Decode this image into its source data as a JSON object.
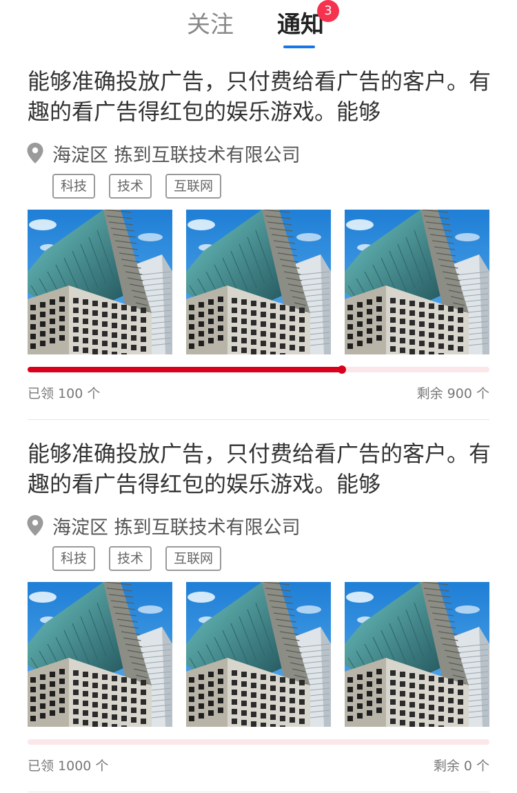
{
  "tabs": {
    "follow": "关注",
    "notice": "通知",
    "notice_badge": "3"
  },
  "colors": {
    "accent_blue": "#1677e8",
    "badge_red": "#f5334f",
    "progress_red": "#d9001b",
    "progress_track": "#fbe7e9"
  },
  "cards": [
    {
      "title": "能够准确投放广告，只付费给看广告的客户。有趣的看广告得红包的娱乐游戏。能够",
      "location": "海淀区 拣到互联技术有限公司",
      "tags": [
        "科技",
        "技术",
        "互联网"
      ],
      "images": [
        "building-photo",
        "building-photo",
        "building-photo"
      ],
      "progress_fraction": 0.68,
      "claimed": "已领 100 个",
      "remaining": "剩余 900 个"
    },
    {
      "title": "能够准确投放广告，只付费给看广告的客户。有趣的看广告得红包的娱乐游戏。能够",
      "location": "海淀区 拣到互联技术有限公司",
      "tags": [
        "科技",
        "技术",
        "互联网"
      ],
      "images": [
        "building-photo",
        "building-photo",
        "building-photo"
      ],
      "progress_fraction": 0,
      "claimed": "已领 1000 个",
      "remaining": "剩余 0 个"
    }
  ]
}
